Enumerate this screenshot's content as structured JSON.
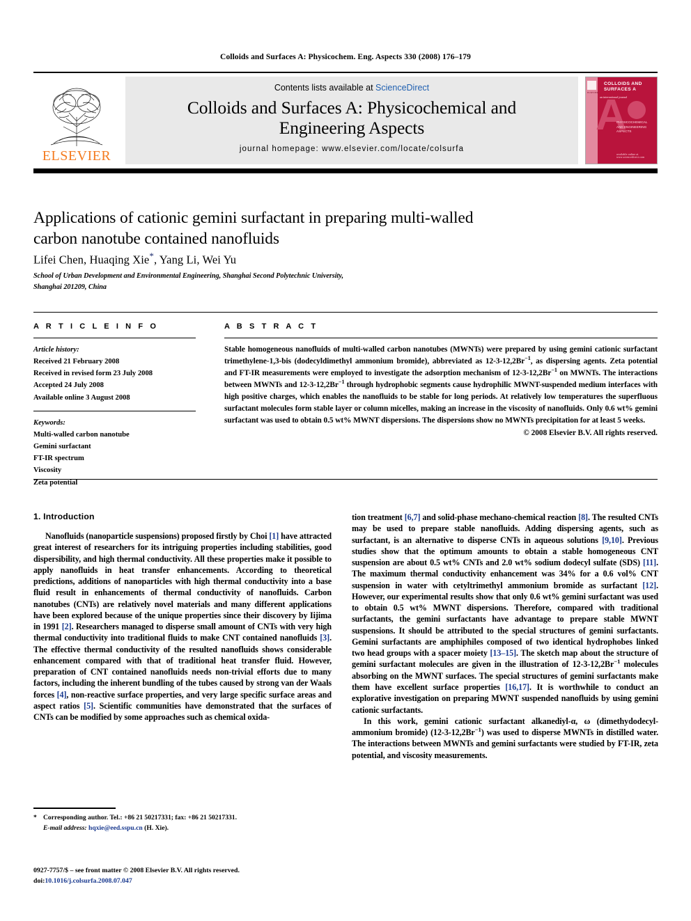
{
  "running_head": "Colloids and Surfaces A: Physicochem. Eng. Aspects 330 (2008) 176–179",
  "masthead": {
    "contents_prefix": "Contents lists available at ",
    "sciencedirect": "ScienceDirect",
    "journal_title_line1": "Colloids and Surfaces A: Physicochemical and",
    "journal_title_line2": "Engineering Aspects",
    "homepage": "journal homepage: www.elsevier.com/locate/colsurfa",
    "publisher": "ELSEVIER",
    "accent_orange": "#f47b20",
    "link_blue": "#2060b0",
    "cover": {
      "title": "COLLOIDS AND SURFACES A",
      "letter": "A",
      "subtitle": "PHYSICOCHEMICAL AND ENGINEERING ASPECTS",
      "intl": "an international journal",
      "bottom": "available online at www.sciencedirect.com",
      "color": "#b9143c"
    }
  },
  "article": {
    "title": "Applications of cationic gemini surfactant in preparing multi-walled carbon nanotube contained nanofluids",
    "authors_before_star": "Lifei Chen, Huaqing Xie",
    "author_star": "*",
    "authors_after_star": ", Yang Li, Wei Yu",
    "affiliation_line1": "School of Urban Development and Environmental Engineering, Shanghai Second Polytechnic University,",
    "affiliation_line2": "Shanghai 201209, China"
  },
  "article_info": {
    "heading": "A R T I C L E   I N F O",
    "history_label": "Article history:",
    "history": [
      "Received 21 February 2008",
      "Received in revised form 23 July 2008",
      "Accepted 24 July 2008",
      "Available online 3 August 2008"
    ],
    "keywords_label": "Keywords:",
    "keywords": [
      "Multi-walled carbon nanotube",
      "Gemini surfactant",
      "FT-IR spectrum",
      "Viscosity",
      "Zeta potential"
    ]
  },
  "abstract": {
    "heading": "A B S T R A C T",
    "paragraph_1": "Stable homogeneous nanofluids of multi-walled carbon nanotubes (MWNTs) were prepared by using gemini cationic surfactant trimethylene-1,3-bis (dodecyldimethyl ammonium bromide), abbreviated as 12-3-12,2Br",
    "sup_1": "−1",
    "paragraph_2": ", as dispersing agents. Zeta potential and FT-IR measurements were employed to investigate the adsorption mechanism of 12-3-12,2Br",
    "sup_2": "−1",
    "paragraph_3": " on MWNTs. The interactions between MWNTs and 12-3-12,2Br",
    "sup_3": "−1",
    "paragraph_4": " through hydrophobic segments cause hydrophilic MWNT-suspended medium interfaces with high positive charges, which enables the nanofluids to be stable for long periods. At relatively low temperatures the superfluous surfactant molecules form stable layer or column micelles, making an increase in the viscosity of nanofluids. Only 0.6 wt% gemini surfactant was used to obtain 0.5 wt% MWNT dispersions. The dispersions show no MWNTs precipitation for at least 5 weeks.",
    "copyright": "© 2008 Elsevier B.V. All rights reserved."
  },
  "introduction": {
    "heading": "1.  Introduction",
    "left_paragraph": {
      "t1": "Nanofluids (nanoparticle suspensions) proposed firstly by Choi ",
      "r1": "[1]",
      "t2": " have attracted great interest of researchers for its intriguing properties including stabilities, good dispersibility, and high thermal conductivity. All these properties make it possible to apply nanofluids in heat transfer enhancements. According to theoretical predictions, additions of nanoparticles with high thermal conductivity into a base fluid result in enhancements of thermal conductivity of nanofluids. Carbon nanotubes (CNTs) are relatively novel materials and many different applications have been explored because of the unique properties since their discovery by Iijima in 1991 ",
      "r2": "[2]",
      "t3": ". Researchers managed to disperse small amount of CNTs with very high thermal conductivity into traditional fluids to make CNT contained nanofluids ",
      "r3": "[3]",
      "t4": ". The effective thermal conductivity of the resulted nanofluids shows considerable enhancement compared with that of traditional heat transfer fluid. However, preparation of CNT contained nanofluids needs non-trivial efforts due to many factors, including the inherent bundling of the tubes caused by strong van der Waals forces ",
      "r4": "[4]",
      "t5": ", non-reactive surface properties, and very large specific surface areas and aspect ratios ",
      "r5": "[5]",
      "t6": ". Scientific communities have demonstrated that the surfaces of CNTs can be modified by some approaches such as chemical oxida-"
    },
    "right_paragraph_1": {
      "t1": "tion treatment ",
      "r1": "[6,7]",
      "t2": " and solid-phase mechano-chemical reaction ",
      "r2": "[8]",
      "t3": ". The resulted CNTs may be used to prepare stable nanofluids. Adding dispersing agents, such as surfactant, is an alternative to disperse CNTs in aqueous solutions ",
      "r3": "[9,10]",
      "t4": ". Previous studies show that the optimum amounts to obtain a stable homogeneous CNT suspension are about 0.5 wt% CNTs and 2.0 wt% sodium dodecyl sulfate (SDS) ",
      "r4": "[11]",
      "t5": ". The maximum thermal conductivity enhancement was 34% for a 0.6 vol% CNT suspension in water with cetyltrimethyl ammonium bromide as surfactant ",
      "r5": "[12]",
      "t6": ". However, our experimental results show that only 0.6 wt% gemini surfactant was used to obtain 0.5 wt% MWNT dispersions. Therefore, compared with traditional surfactants, the gemini surfactants have advantage to prepare stable MWNT suspensions. It should be attributed to the special structures of gemini surfactants. Gemini surfactants are amphiphiles composed of two identical hydrophobes linked two head groups with a spacer moiety ",
      "r6": "[13–15]",
      "t7": ". The sketch map about the structure of gemini surfactant molecules are given in the illustration of 12-3-12,2Br",
      "sup1": "−1",
      "t8": " molecules absorbing on the MWNT surfaces. The special structures of gemini surfactants make them have excellent surface properties ",
      "r7": "[16,17]",
      "t9": ". It is worthwhile to conduct an explorative investigation on preparing MWNT suspended nanofluids by using gemini cationic surfactants."
    },
    "right_paragraph_2": {
      "t1": "In this work, gemini cationic surfactant alkanediyl-α, ω (dimethydodecyl-ammonium bromide) (12-3-12,2Br",
      "sup1": "−1",
      "t2": ") was used to disperse MWNTs in distilled water. The interactions between MWNTs and gemini surfactants were studied by FT-IR, zeta potential, and viscosity measurements."
    }
  },
  "footnote": {
    "star": "*",
    "corresponding": "Corresponding author. Tel.: +86 21 50217331; fax: +86 21 50217331.",
    "email_label": "E-mail address:",
    "email": "hqxie@eed.sspu.cn",
    "email_owner": "(H. Xie)."
  },
  "footer": {
    "line1": "0927-7757/$ – see front matter © 2008 Elsevier B.V. All rights reserved.",
    "doi_label": "doi:",
    "doi": "10.1016/j.colsurfa.2008.07.047"
  }
}
